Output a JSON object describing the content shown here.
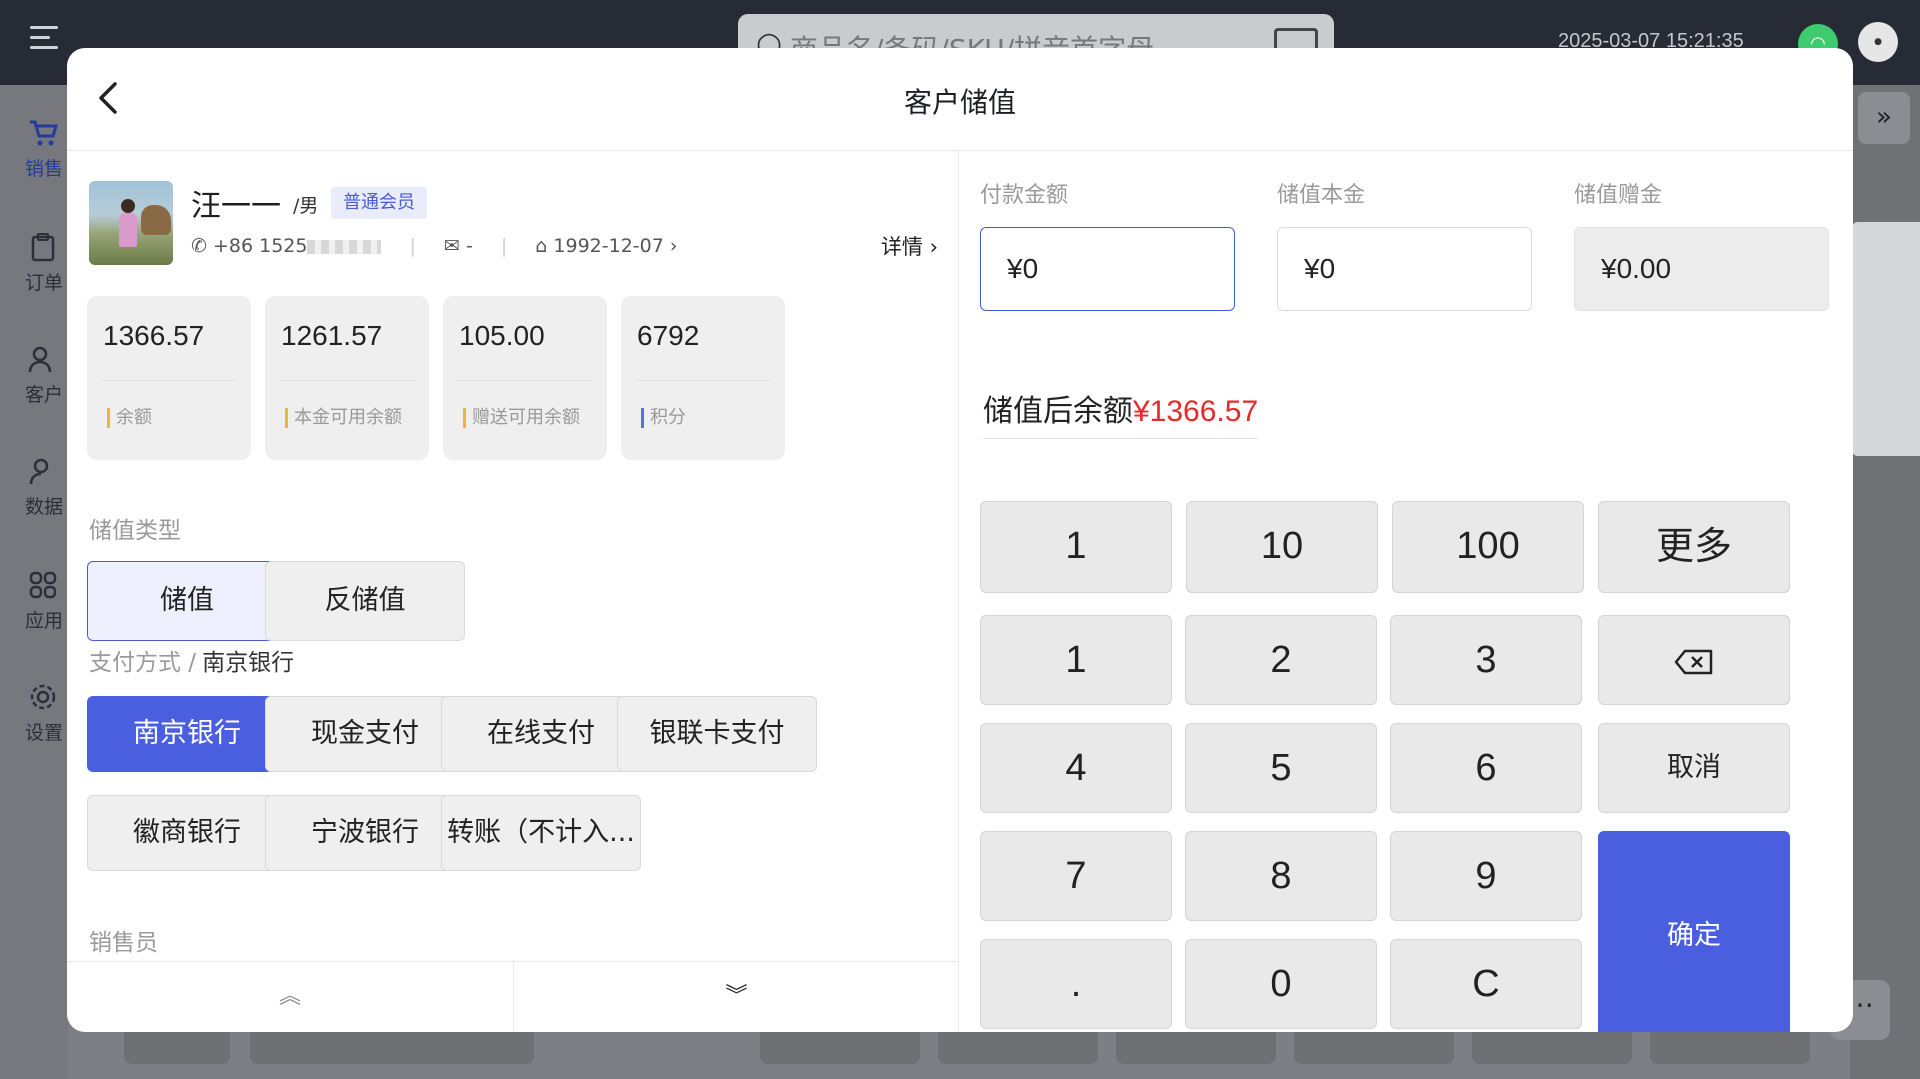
{
  "topbar": {
    "search_placeholder": "商品名/条码/SKU/拼音首字母",
    "datetime": "2025-03-07 15:21:35"
  },
  "sidebar": {
    "items": [
      {
        "label": "销售",
        "icon": "cart-icon"
      },
      {
        "label": "订单",
        "icon": "clipboard-icon"
      },
      {
        "label": "客户",
        "icon": "users-icon"
      },
      {
        "label": "数据",
        "icon": "user-data-icon"
      },
      {
        "label": "应用",
        "icon": "apps-grid-icon"
      },
      {
        "label": "设置",
        "icon": "gear-icon"
      }
    ]
  },
  "modal": {
    "title": "客户储值"
  },
  "customer": {
    "name": "汪一一",
    "gender": "/男",
    "member_level": "普通会员",
    "phone": "+86 1525",
    "email": "-",
    "birthday": "1992-12-07",
    "detail_link": "详情"
  },
  "stats": [
    {
      "value": "1366.57",
      "label": "余额"
    },
    {
      "value": "1261.57",
      "label": "本金可用余额"
    },
    {
      "value": "105.00",
      "label": "赠送可用余额"
    },
    {
      "value": "6792",
      "label": "积分"
    }
  ],
  "recharge_type": {
    "label": "储值类型",
    "options": [
      "储值",
      "反储值"
    ],
    "selected": "储值"
  },
  "payment": {
    "label": "支付方式 /",
    "selected": "南京银行",
    "options": [
      "南京银行",
      "现金支付",
      "在线支付",
      "银联卡支付",
      "徽商银行",
      "宁波银行",
      "转账（不计入..."
    ]
  },
  "salesperson_label": "销售员",
  "amounts": {
    "pay_label": "付款金额",
    "pay_value": "¥0",
    "principal_label": "储值本金",
    "principal_value": "¥0",
    "bonus_label": "储值赠金",
    "bonus_value": "¥0.00"
  },
  "balance_after": {
    "label": "储值后余额",
    "value": "¥1366.57"
  },
  "keypad": {
    "quick": [
      "1",
      "10",
      "100",
      "更多"
    ],
    "rows": [
      [
        "1",
        "2",
        "3"
      ],
      [
        "4",
        "5",
        "6"
      ],
      [
        "7",
        "8",
        "9"
      ],
      [
        ".",
        "0",
        "C"
      ]
    ],
    "cancel": "取消",
    "confirm": "确定"
  },
  "colors": {
    "accent": "#4a5fe0",
    "highlight_red": "#e62a2a",
    "badge_bg": "#e8ecfb"
  }
}
